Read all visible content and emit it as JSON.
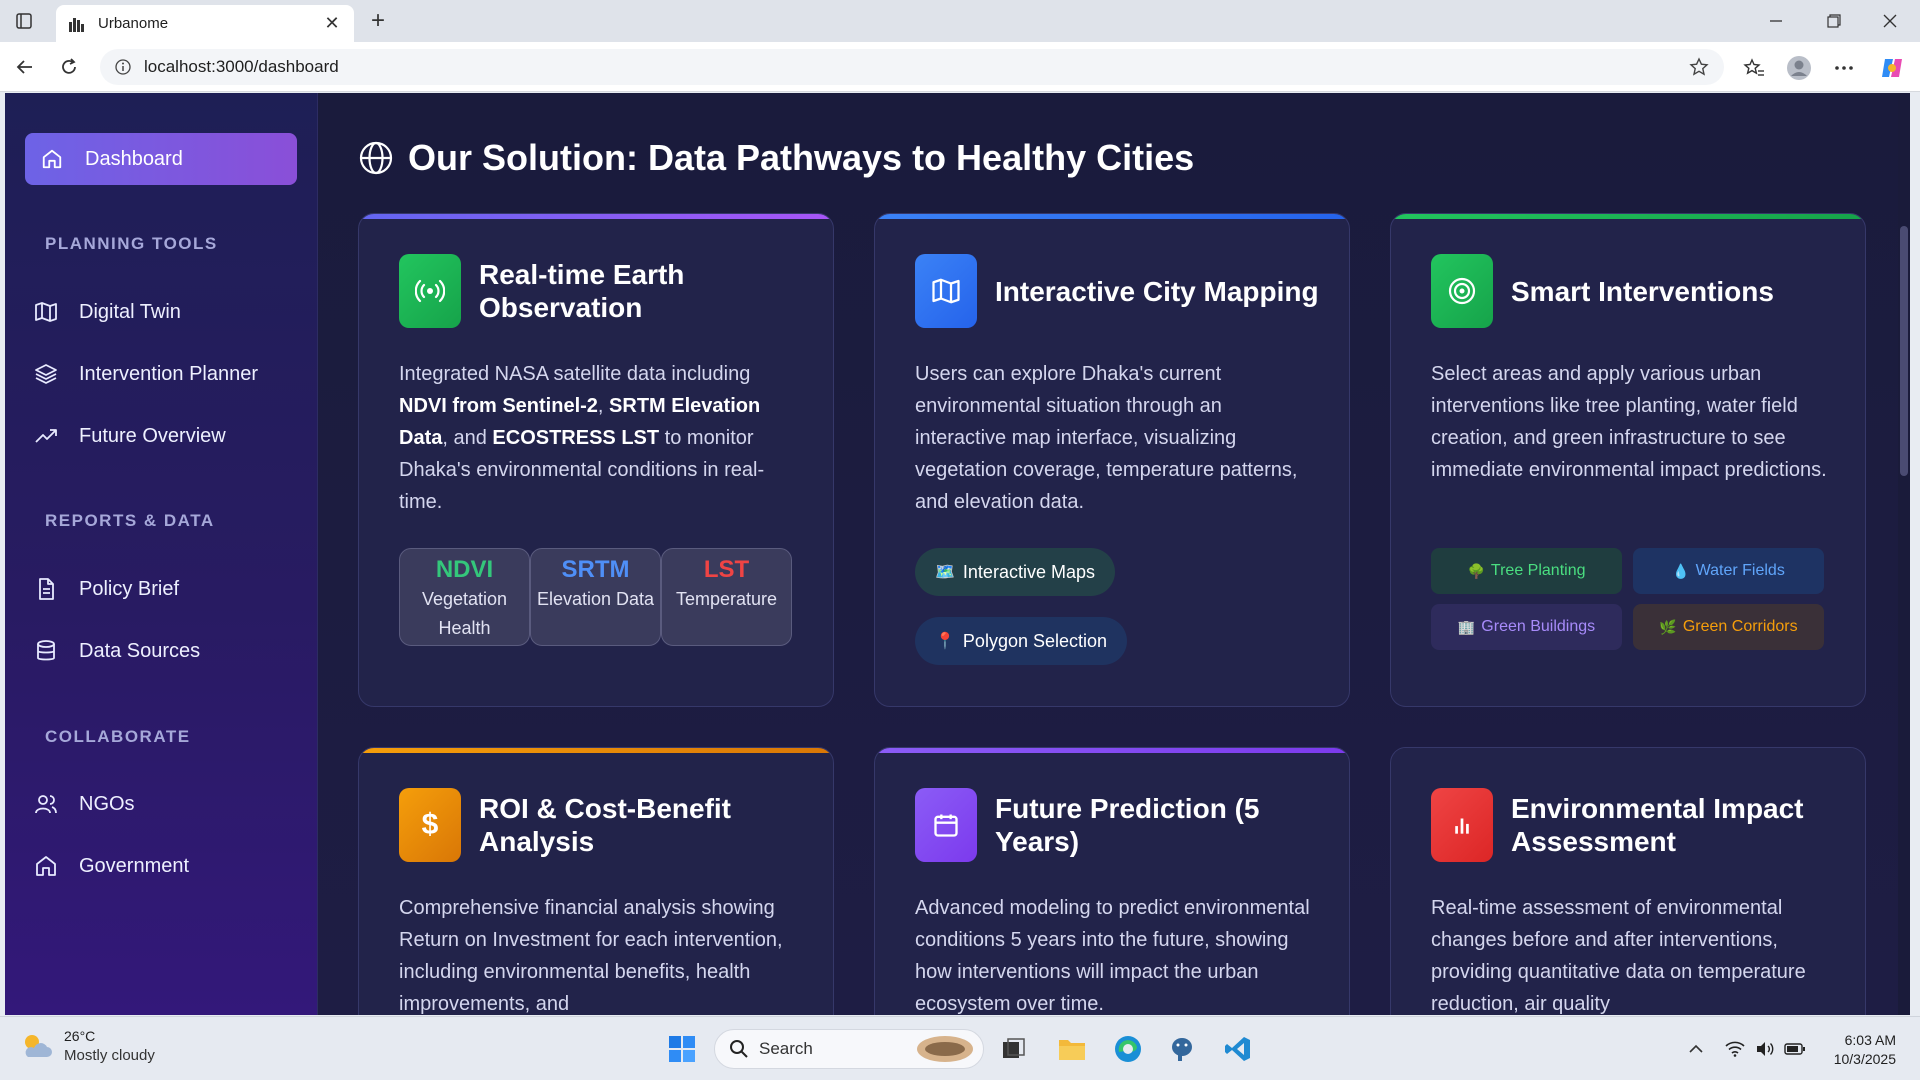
{
  "browser": {
    "tab_title": "Urbanome",
    "url": "localhost:3000/dashboard"
  },
  "sidebar": {
    "active_item": {
      "label": "Dashboard",
      "icon": "home-icon"
    },
    "sections": [
      {
        "title": "PLANNING TOOLS",
        "items": [
          {
            "label": "Digital Twin",
            "icon": "map-icon"
          },
          {
            "label": "Intervention Planner",
            "icon": "layers-icon"
          },
          {
            "label": "Future Overview",
            "icon": "trending-up-icon"
          }
        ]
      },
      {
        "title": "REPORTS & DATA",
        "items": [
          {
            "label": "Policy Brief",
            "icon": "document-icon"
          },
          {
            "label": "Data Sources",
            "icon": "database-icon"
          }
        ]
      },
      {
        "title": "COLLABORATE",
        "items": [
          {
            "label": "NGOs",
            "icon": "users-icon"
          },
          {
            "label": "Government",
            "icon": "building-icon"
          }
        ]
      }
    ]
  },
  "main": {
    "title": "Our Solution: Data Pathways to Healthy Cities",
    "cards": [
      {
        "title": "Real-time Earth Observation",
        "body_parts": [
          "Integrated NASA satellite data including ",
          "NDVI from Sentinel-2",
          ", ",
          "SRTM Elevation Data",
          ", and ",
          "ECOSTRESS LST",
          " to monitor Dhaka's environmental conditions in real-time."
        ],
        "accent": "#8b5cf6",
        "metrics": [
          {
            "name": "NDVI",
            "desc": "Vegetation Health",
            "color": "#34c77b"
          },
          {
            "name": "SRTM",
            "desc": "Elevation Data",
            "color": "#4f8ff7"
          },
          {
            "name": "LST",
            "desc": "Temperature",
            "color": "#ef4444"
          }
        ]
      },
      {
        "title": "Interactive City Mapping",
        "body": "Users can explore Dhaka's current environmental situation through an interactive map interface, visualizing vegetation coverage, temperature patterns, and elevation data.",
        "accent": "#3b82f6",
        "pills": [
          {
            "emoji": "🗺️",
            "label": "Interactive Maps"
          },
          {
            "emoji": "📍",
            "label": "Polygon Selection"
          }
        ]
      },
      {
        "title": "Smart Interventions",
        "body": "Select areas and apply various urban interventions like tree planting, water field creation, and green infrastructure to see immediate environmental impact predictions.",
        "accent": "#22c55e",
        "chips": [
          {
            "emoji": "🌳",
            "label": "Tree Planting",
            "color": "#4ade80"
          },
          {
            "emoji": "💧",
            "label": "Water Fields",
            "color": "#60a5fa"
          },
          {
            "emoji": "🏢",
            "label": "Green Buildings",
            "color": "#a78bfa"
          },
          {
            "emoji": "🌿",
            "label": "Green Corridors",
            "color": "#f59e0b"
          }
        ]
      },
      {
        "title": "ROI & Cost-Benefit Analysis",
        "body": "Comprehensive financial analysis showing Return on Investment for each intervention, including environmental benefits, health improvements, and",
        "accent": "#f59e0b"
      },
      {
        "title": "Future Prediction (5 Years)",
        "body": "Advanced modeling to predict environmental conditions 5 years into the future, showing how interventions will impact the urban ecosystem over time.",
        "accent": "#8b5cf6"
      },
      {
        "title": "Environmental Impact Assessment",
        "body": "Real-time assessment of environmental changes before and after interventions, providing quantitative data on temperature reduction, air quality",
        "accent": "#ef4444"
      }
    ]
  },
  "taskbar": {
    "weather_temp": "26°C",
    "weather_condition": "Mostly cloudy",
    "search_label": "Search",
    "time": "6:03 AM",
    "date": "10/3/2025"
  }
}
